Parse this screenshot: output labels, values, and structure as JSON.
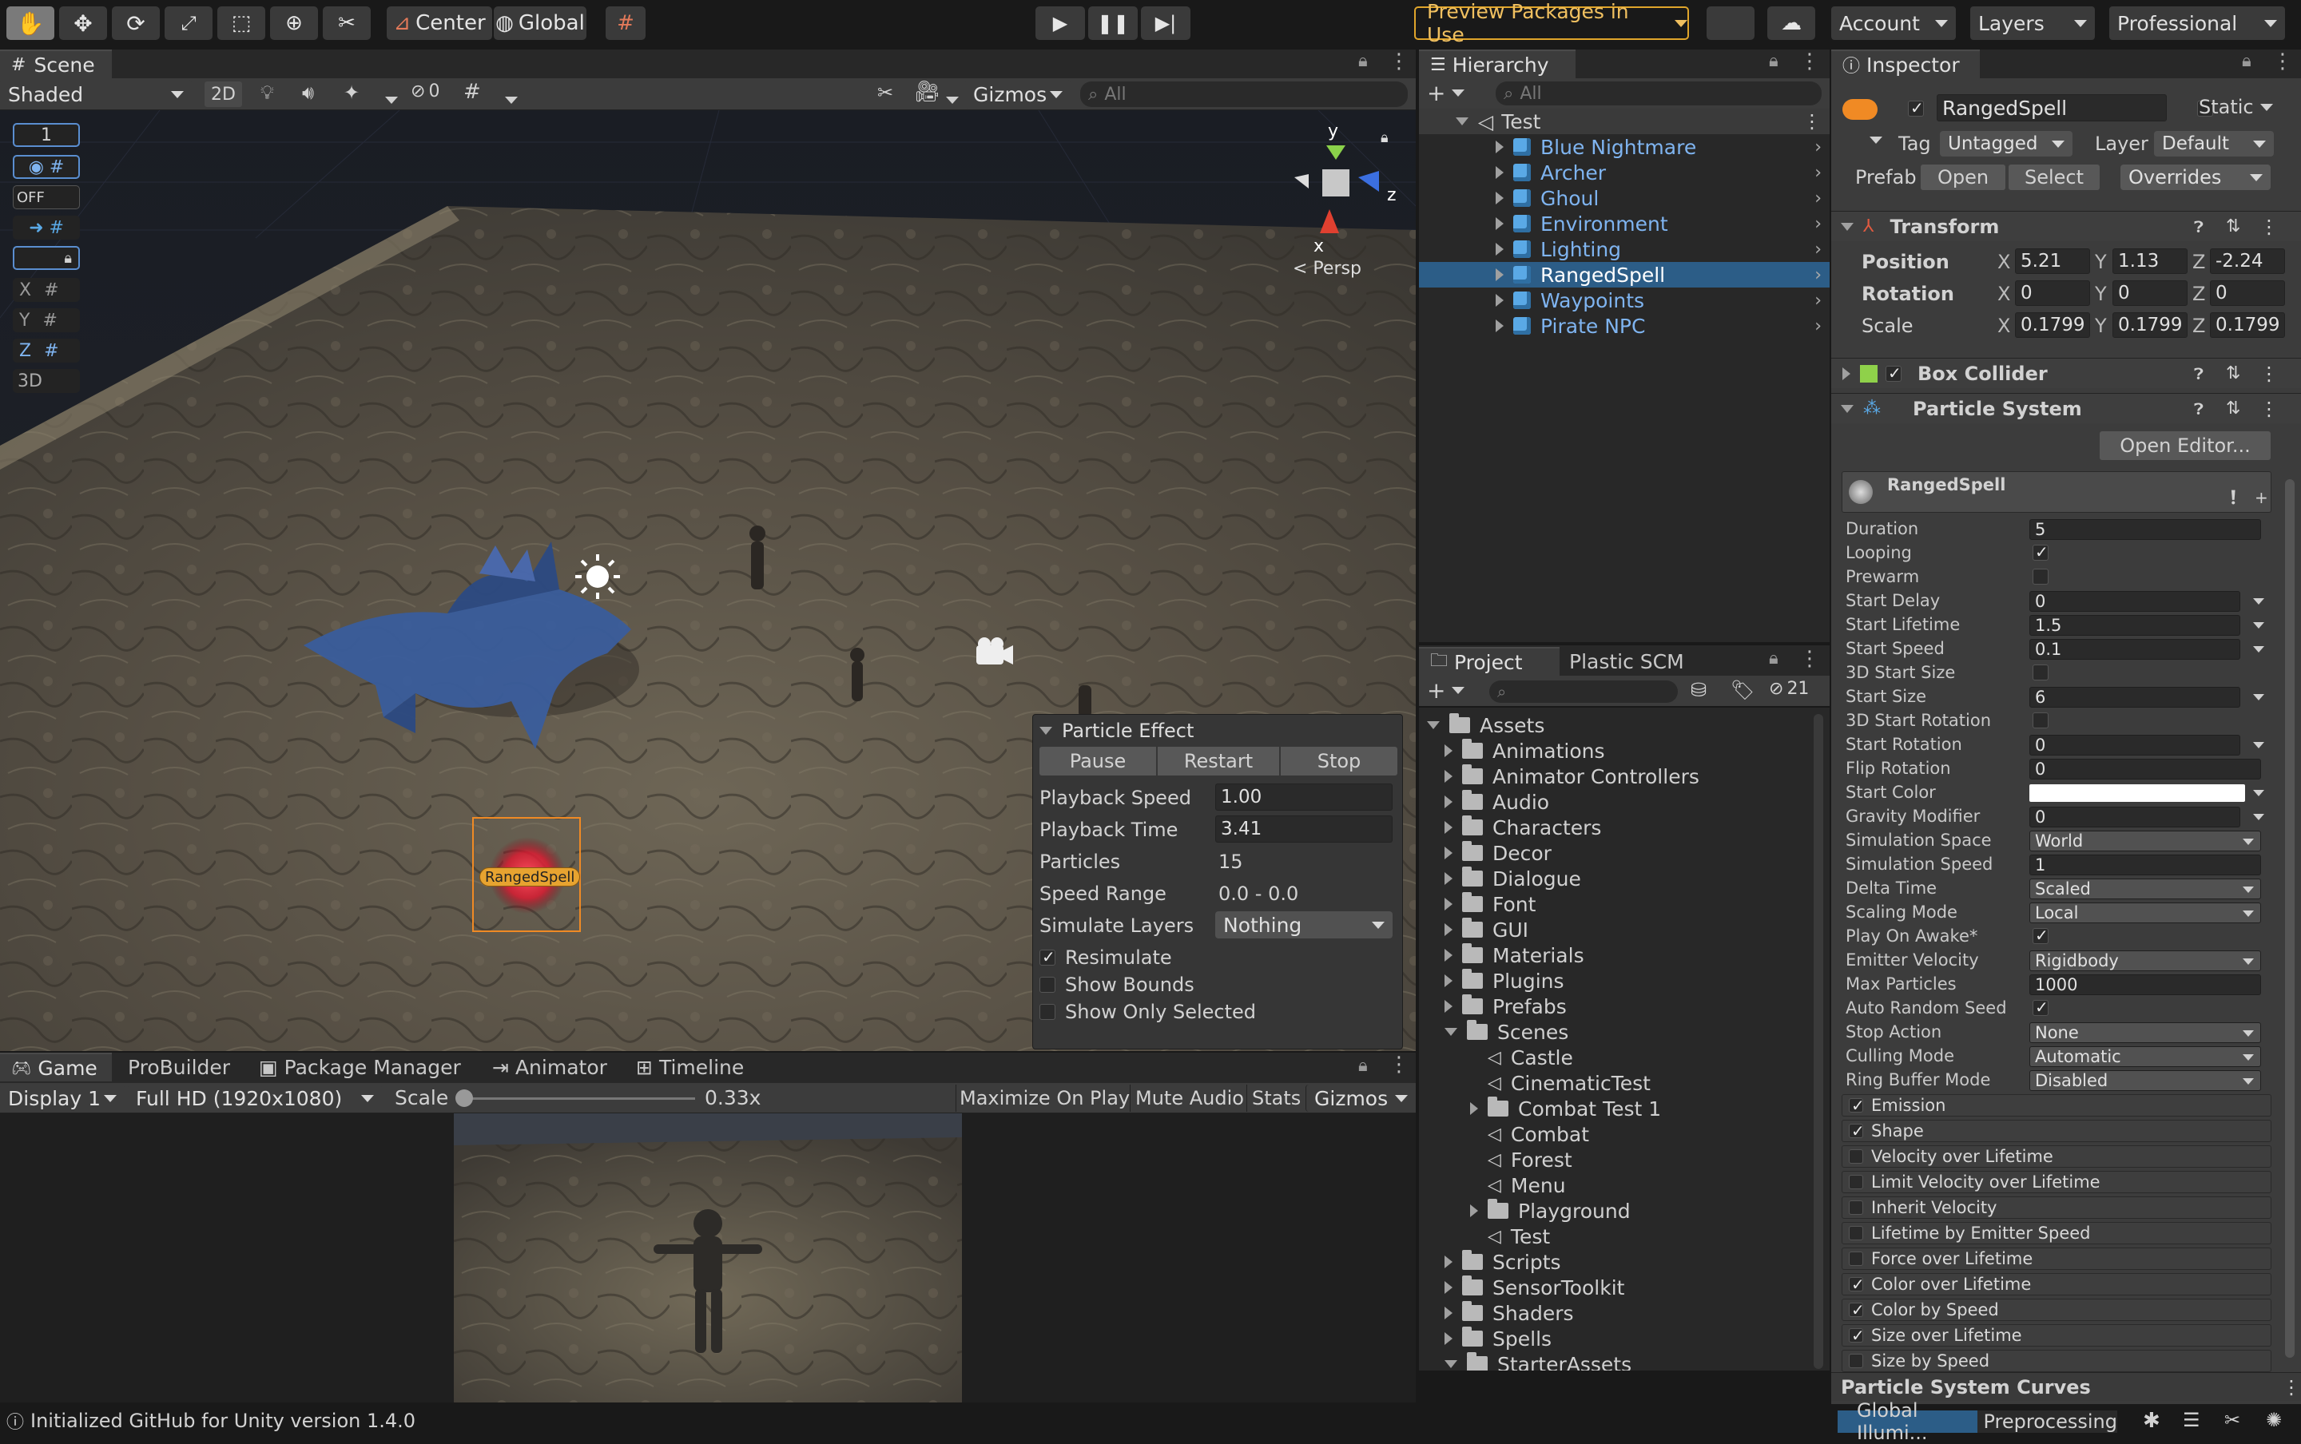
{
  "toolbar": {
    "center_label": "Center",
    "global_label": "Global",
    "preview_packages": "Preview Packages in Use",
    "account": "Account",
    "layers": "Layers",
    "layout": "Professional"
  },
  "scene": {
    "tab": "Scene",
    "shading": "Shaded",
    "mode2d": "2D",
    "hidden_count": "0",
    "gizmos": "Gizmos",
    "search_placeholder": "All",
    "overlay": [
      "1",
      "OFF",
      "X",
      "Y",
      "Z",
      "3D"
    ],
    "gizmo_axes": {
      "y": "y",
      "z": "z",
      "x": "x"
    },
    "persp": "< Persp",
    "object_label": "RangedSpell"
  },
  "particle_effect": {
    "title": "Particle Effect",
    "pause": "Pause",
    "restart": "Restart",
    "stop": "Stop",
    "rows": [
      {
        "label": "Playback Speed",
        "value": "1.00"
      },
      {
        "label": "Playback Time",
        "value": "3.41"
      },
      {
        "label": "Particles",
        "value": "15"
      },
      {
        "label": "Speed Range",
        "value": "0.0 - 0.0"
      },
      {
        "label": "Simulate Layers",
        "value": "Nothing"
      }
    ],
    "checks": [
      {
        "label": "Resimulate",
        "checked": true
      },
      {
        "label": "Show Bounds",
        "checked": false
      },
      {
        "label": "Show Only Selected",
        "checked": false
      }
    ]
  },
  "game": {
    "tabs": [
      "Game",
      "ProBuilder",
      "Package Manager",
      "Animator",
      "Timeline"
    ],
    "display": "Display 1",
    "resolution": "Full HD (1920x1080)",
    "scale_label": "Scale",
    "scale_value": "0.33x",
    "buttons": [
      "Maximize On Play",
      "Mute Audio",
      "Stats",
      "Gizmos"
    ]
  },
  "hierarchy": {
    "tab": "Hierarchy",
    "search_placeholder": "All",
    "scene": "Test",
    "items": [
      "Blue Nightmare",
      "Archer",
      "Ghoul",
      "Environment",
      "Lighting",
      "RangedSpell",
      "Waypoints",
      "Pirate NPC"
    ],
    "selected_index": 5
  },
  "project": {
    "tabs": [
      "Project",
      "Plastic SCM"
    ],
    "hidden_count": "21",
    "root": "Assets",
    "items": [
      {
        "name": "Animations",
        "type": "folder",
        "depth": 1,
        "arrow": "right"
      },
      {
        "name": "Animator Controllers",
        "type": "folder",
        "depth": 1,
        "arrow": "right"
      },
      {
        "name": "Audio",
        "type": "folder",
        "depth": 1,
        "arrow": "right"
      },
      {
        "name": "Characters",
        "type": "folder",
        "depth": 1,
        "arrow": "right"
      },
      {
        "name": "Decor",
        "type": "folder",
        "depth": 1,
        "arrow": "right"
      },
      {
        "name": "Dialogue",
        "type": "folder",
        "depth": 1,
        "arrow": "right"
      },
      {
        "name": "Font",
        "type": "folder",
        "depth": 1,
        "arrow": "right"
      },
      {
        "name": "GUI",
        "type": "folder",
        "depth": 1,
        "arrow": "right"
      },
      {
        "name": "Materials",
        "type": "folder",
        "depth": 1,
        "arrow": "right"
      },
      {
        "name": "Plugins",
        "type": "folder",
        "depth": 1,
        "arrow": "right"
      },
      {
        "name": "Prefabs",
        "type": "folder",
        "depth": 1,
        "arrow": "right"
      },
      {
        "name": "Scenes",
        "type": "folder",
        "depth": 1,
        "arrow": "down"
      },
      {
        "name": "Castle",
        "type": "scene",
        "depth": 2,
        "arrow": "none"
      },
      {
        "name": "CinematicTest",
        "type": "scene",
        "depth": 2,
        "arrow": "none"
      },
      {
        "name": "Combat Test 1",
        "type": "folder",
        "depth": 2,
        "arrow": "right"
      },
      {
        "name": "Combat",
        "type": "scene",
        "depth": 2,
        "arrow": "none"
      },
      {
        "name": "Forest",
        "type": "scene",
        "depth": 2,
        "arrow": "none"
      },
      {
        "name": "Menu",
        "type": "scene",
        "depth": 2,
        "arrow": "none"
      },
      {
        "name": "Playground",
        "type": "folder",
        "depth": 2,
        "arrow": "right"
      },
      {
        "name": "Test",
        "type": "scene",
        "depth": 2,
        "arrow": "none"
      },
      {
        "name": "Scripts",
        "type": "folder",
        "depth": 1,
        "arrow": "right"
      },
      {
        "name": "SensorToolkit",
        "type": "folder",
        "depth": 1,
        "arrow": "right"
      },
      {
        "name": "Shaders",
        "type": "folder",
        "depth": 1,
        "arrow": "right"
      },
      {
        "name": "Spells",
        "type": "folder",
        "depth": 1,
        "arrow": "right"
      },
      {
        "name": "StarterAssets",
        "type": "folder",
        "depth": 1,
        "arrow": "down"
      }
    ]
  },
  "inspector": {
    "tab": "Inspector",
    "object_name": "RangedSpell",
    "static_label": "Static",
    "tag_label": "Tag",
    "tag_value": "Untagged",
    "layer_label": "Layer",
    "layer_value": "Default",
    "prefab_label": "Prefab",
    "open": "Open",
    "select": "Select",
    "overrides": "Overrides",
    "transform": {
      "title": "Transform",
      "rows": [
        {
          "label": "Position",
          "x": "5.21",
          "y": "1.13",
          "z": "-2.24"
        },
        {
          "label": "Rotation",
          "x": "0",
          "y": "0",
          "z": "0"
        },
        {
          "label": "Scale",
          "x": "0.1799",
          "y": "0.1799",
          "z": "0.1799"
        }
      ],
      "axis": [
        "X",
        "Y",
        "Z"
      ]
    },
    "box_collider": "Box Collider",
    "particle_system": "Particle System",
    "open_editor": "Open Editor...",
    "ps_name": "RangedSpell",
    "props": [
      {
        "label": "Duration",
        "value": "5",
        "kind": "field"
      },
      {
        "label": "Looping",
        "value": true,
        "kind": "check"
      },
      {
        "label": "Prewarm",
        "value": false,
        "kind": "check"
      },
      {
        "label": "Start Delay",
        "value": "0",
        "kind": "fieldmenu"
      },
      {
        "label": "Start Lifetime",
        "value": "1.5",
        "kind": "fieldmenu"
      },
      {
        "label": "Start Speed",
        "value": "0.1",
        "kind": "fieldmenu"
      },
      {
        "label": "3D Start Size",
        "value": false,
        "kind": "check"
      },
      {
        "label": "Start Size",
        "value": "6",
        "kind": "fieldmenu"
      },
      {
        "label": "3D Start Rotation",
        "value": false,
        "kind": "check"
      },
      {
        "label": "Start Rotation",
        "value": "0",
        "kind": "fieldmenu"
      },
      {
        "label": "Flip Rotation",
        "value": "0",
        "kind": "field"
      },
      {
        "label": "Start Color",
        "value": "#ffffff",
        "kind": "color"
      },
      {
        "label": "Gravity Modifier",
        "value": "0",
        "kind": "fieldmenu"
      },
      {
        "label": "Simulation Space",
        "value": "World",
        "kind": "dropdown"
      },
      {
        "label": "Simulation Speed",
        "value": "1",
        "kind": "field"
      },
      {
        "label": "Delta Time",
        "value": "Scaled",
        "kind": "dropdown"
      },
      {
        "label": "Scaling Mode",
        "value": "Local",
        "kind": "dropdown"
      },
      {
        "label": "Play On Awake*",
        "value": true,
        "kind": "check"
      },
      {
        "label": "Emitter Velocity",
        "value": "Rigidbody",
        "kind": "dropdown"
      },
      {
        "label": "Max Particles",
        "value": "1000",
        "kind": "field"
      },
      {
        "label": "Auto Random Seed",
        "value": true,
        "kind": "check"
      },
      {
        "label": "Stop Action",
        "value": "None",
        "kind": "dropdown"
      },
      {
        "label": "Culling Mode",
        "value": "Automatic",
        "kind": "dropdown"
      },
      {
        "label": "Ring Buffer Mode",
        "value": "Disabled",
        "kind": "dropdown"
      }
    ],
    "modules": [
      {
        "label": "Emission",
        "on": true
      },
      {
        "label": "Shape",
        "on": true
      },
      {
        "label": "Velocity over Lifetime",
        "on": false
      },
      {
        "label": "Limit Velocity over Lifetime",
        "on": false
      },
      {
        "label": "Inherit Velocity",
        "on": false
      },
      {
        "label": "Lifetime by Emitter Speed",
        "on": false
      },
      {
        "label": "Force over Lifetime",
        "on": false
      },
      {
        "label": "Color over Lifetime",
        "on": true
      },
      {
        "label": "Color by Speed",
        "on": true
      },
      {
        "label": "Size over Lifetime",
        "on": true
      },
      {
        "label": "Size by Speed",
        "on": false
      }
    ],
    "curves_title": "Particle System Curves"
  },
  "status": {
    "message": "Initialized GitHub for Unity version 1.4.0",
    "gi": "Global Illumi...",
    "preprocessing": "Preprocessing"
  },
  "colors": {
    "accent": "#2c5d87",
    "selection": "#2c5d87",
    "preview_border": "#e0a52b",
    "link_blue": "#7fb4f0",
    "object_orange": "#f08a24"
  }
}
